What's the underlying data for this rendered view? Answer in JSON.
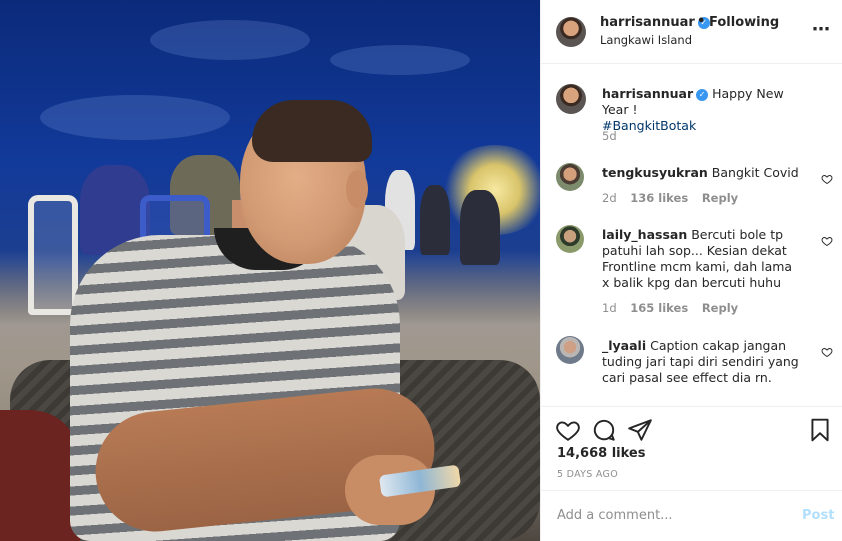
{
  "post": {
    "username": "harrisannuar",
    "follow_status": "Following",
    "location": "Langkawi Island",
    "caption_text": "Happy New Year !",
    "hashtag": "#BangkitBotak",
    "caption_age": "5d"
  },
  "comments": [
    {
      "username": "tengkusyukran",
      "text": "Bangkit Covid",
      "age": "2d",
      "likes": "136 likes",
      "reply": "Reply"
    },
    {
      "username": "laily_hassan",
      "text": "Bercuti bole tp patuhi lah sop... Kesian dekat Frontline mcm kami, dah lama x balik kpg dan bercuti huhu",
      "age": "1d",
      "likes": "165 likes",
      "reply": "Reply"
    },
    {
      "username": "_lyaali",
      "text": "Caption cakap jangan tuding jari tapi diri sendiri yang cari pasal see effect dia rn.",
      "age": "",
      "likes": "",
      "reply": ""
    }
  ],
  "stats": {
    "likes": "14,668 likes",
    "posted": "5 DAYS AGO"
  },
  "add_comment": {
    "placeholder": "Add a comment...",
    "post_label": "Post"
  },
  "icons": [
    "heart-icon",
    "comment-icon",
    "share-icon",
    "bookmark-icon",
    "more-icon",
    "verified-icon"
  ],
  "colors": {
    "verified": "#3897f0",
    "post_disabled": "#b2dffc",
    "secondary_text": "#8e8e8e",
    "hashtag": "#00376b"
  }
}
